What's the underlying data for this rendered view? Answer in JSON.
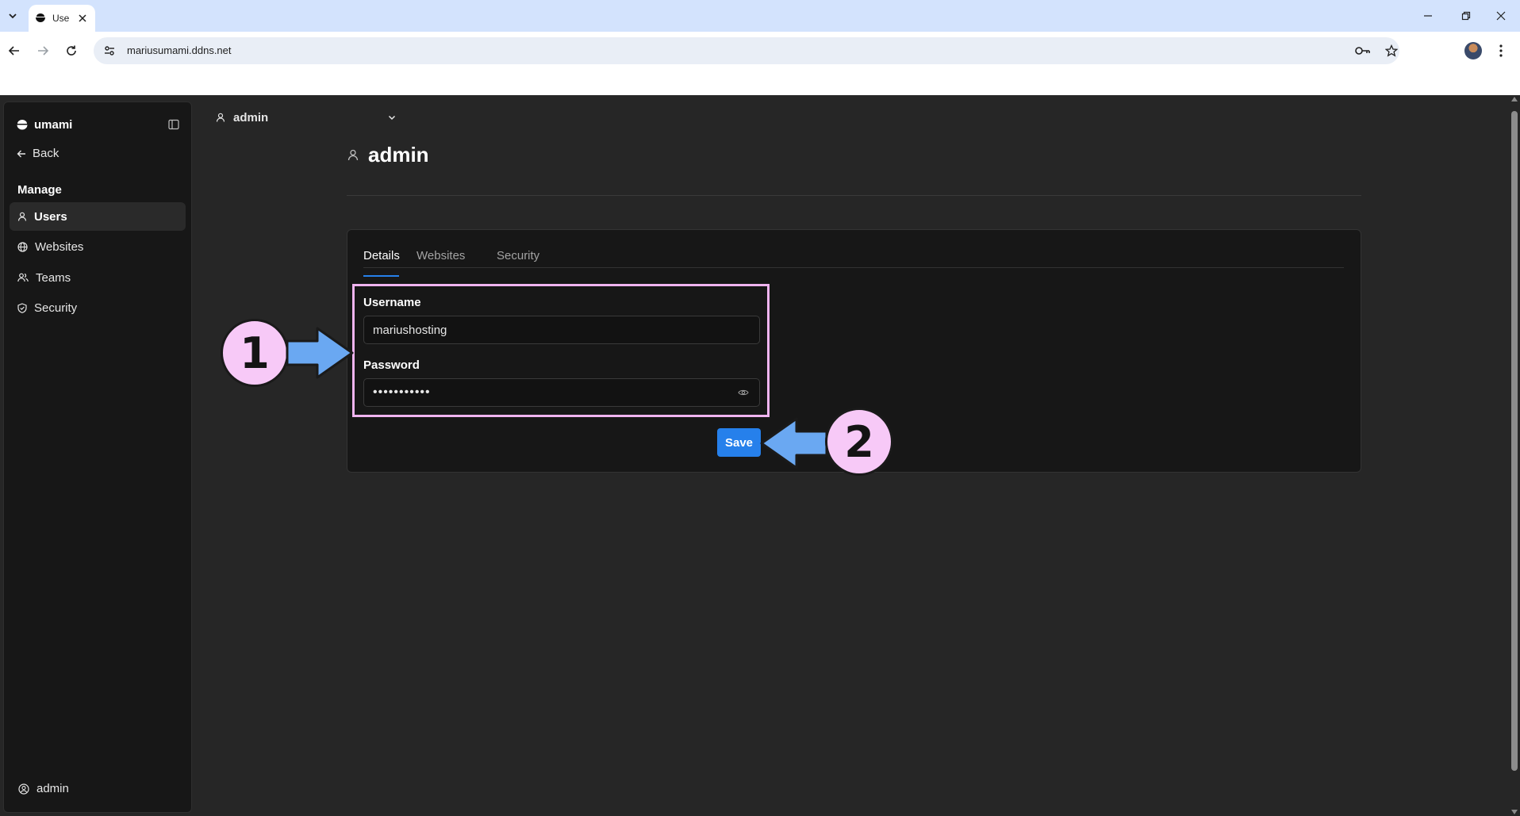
{
  "browser": {
    "tab_title": "Use",
    "url": "mariusumami.ddns.net"
  },
  "sidebar": {
    "brand": "umami",
    "back_label": "Back",
    "section_title": "Manage",
    "items": [
      {
        "label": "Users",
        "icon": "user-icon",
        "active": true
      },
      {
        "label": "Websites",
        "icon": "globe-icon",
        "active": false
      },
      {
        "label": "Teams",
        "icon": "users-icon",
        "active": false
      },
      {
        "label": "Security",
        "icon": "shield-icon",
        "active": false
      }
    ],
    "footer_user": "admin"
  },
  "top_bar": {
    "user_selector": "admin"
  },
  "page": {
    "title": "admin"
  },
  "tabs": [
    {
      "label": "Details",
      "active": true
    },
    {
      "label": "Websites",
      "active": false
    },
    {
      "label": "Security",
      "active": false
    }
  ],
  "form": {
    "username_label": "Username",
    "username_value": "mariushosting",
    "password_label": "Password",
    "password_value": "•••••••••••",
    "save_label": "Save"
  },
  "annotations": {
    "step1": "1",
    "step2": "2"
  },
  "colors": {
    "accent": "#2680eb",
    "highlight": "#f0b4f0",
    "badge_fill": "#f7c9f7",
    "arrow": "#6aa8f2",
    "background": "#262626",
    "panel": "#171717"
  }
}
